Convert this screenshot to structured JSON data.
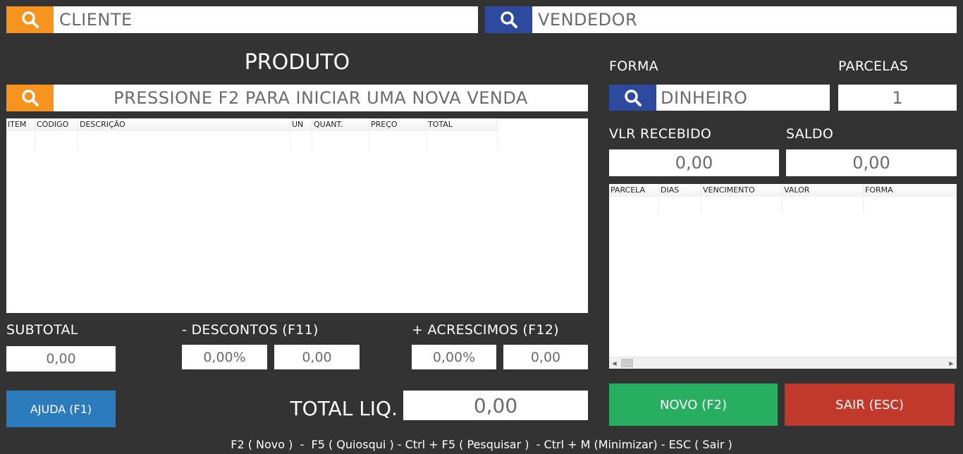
{
  "cliente": {
    "placeholder": "CLIENTE"
  },
  "vendedor": {
    "placeholder": "VENDEDOR"
  },
  "produto": {
    "title": "PRODUTO",
    "search_text": "PRESSIONE F2 PARA INICIAR UMA NOVA VENDA",
    "columns": [
      "ITEM",
      "CÓDIGO",
      "DESCRIÇÃO",
      "UN",
      "QUANT.",
      "PREÇO",
      "TOTAL"
    ]
  },
  "forma": {
    "label": "FORMA",
    "value": "DINHEIRO"
  },
  "parcelas": {
    "label": "PARCELAS",
    "value": "1"
  },
  "vlr_recebido": {
    "label": "VLR RECEBIDO",
    "value": "0,00"
  },
  "saldo": {
    "label": "SALDO",
    "value": "0,00"
  },
  "parcelas_grid": {
    "columns": [
      "PARCELA",
      "DIAS",
      "VENCIMENTO",
      "VALOR",
      "FORMA"
    ]
  },
  "subtotal": {
    "label": "SUBTOTAL",
    "value": "0,00"
  },
  "descontos": {
    "label": "- DESCONTOS (F11)",
    "percent": "0,00%",
    "value": "0,00"
  },
  "acrescimos": {
    "label": "+ ACRESCIMOS (F12)",
    "percent": "0,00%",
    "value": "0,00"
  },
  "total_liq": {
    "label": "TOTAL LIQ.",
    "value": "0,00"
  },
  "buttons": {
    "ajuda": "AJUDA (F1)",
    "novo": "NOVO (F2)",
    "sair": "SAIR (ESC)"
  },
  "shortcuts": "F2 ( Novo )  -  F5 ( Quiosqui ) - Ctrl + F5 ( Pesquisar )  - Ctrl + M (Minimizar) - ESC ( Sair )",
  "colors": {
    "background": "#333333",
    "orange": "#f7941d",
    "blue": "#2e4a9e",
    "help": "#2b7bbd",
    "green": "#27ae60",
    "red": "#c0392b"
  },
  "icons": [
    "search-icon",
    "scroll-left-icon",
    "scroll-right-icon"
  ]
}
